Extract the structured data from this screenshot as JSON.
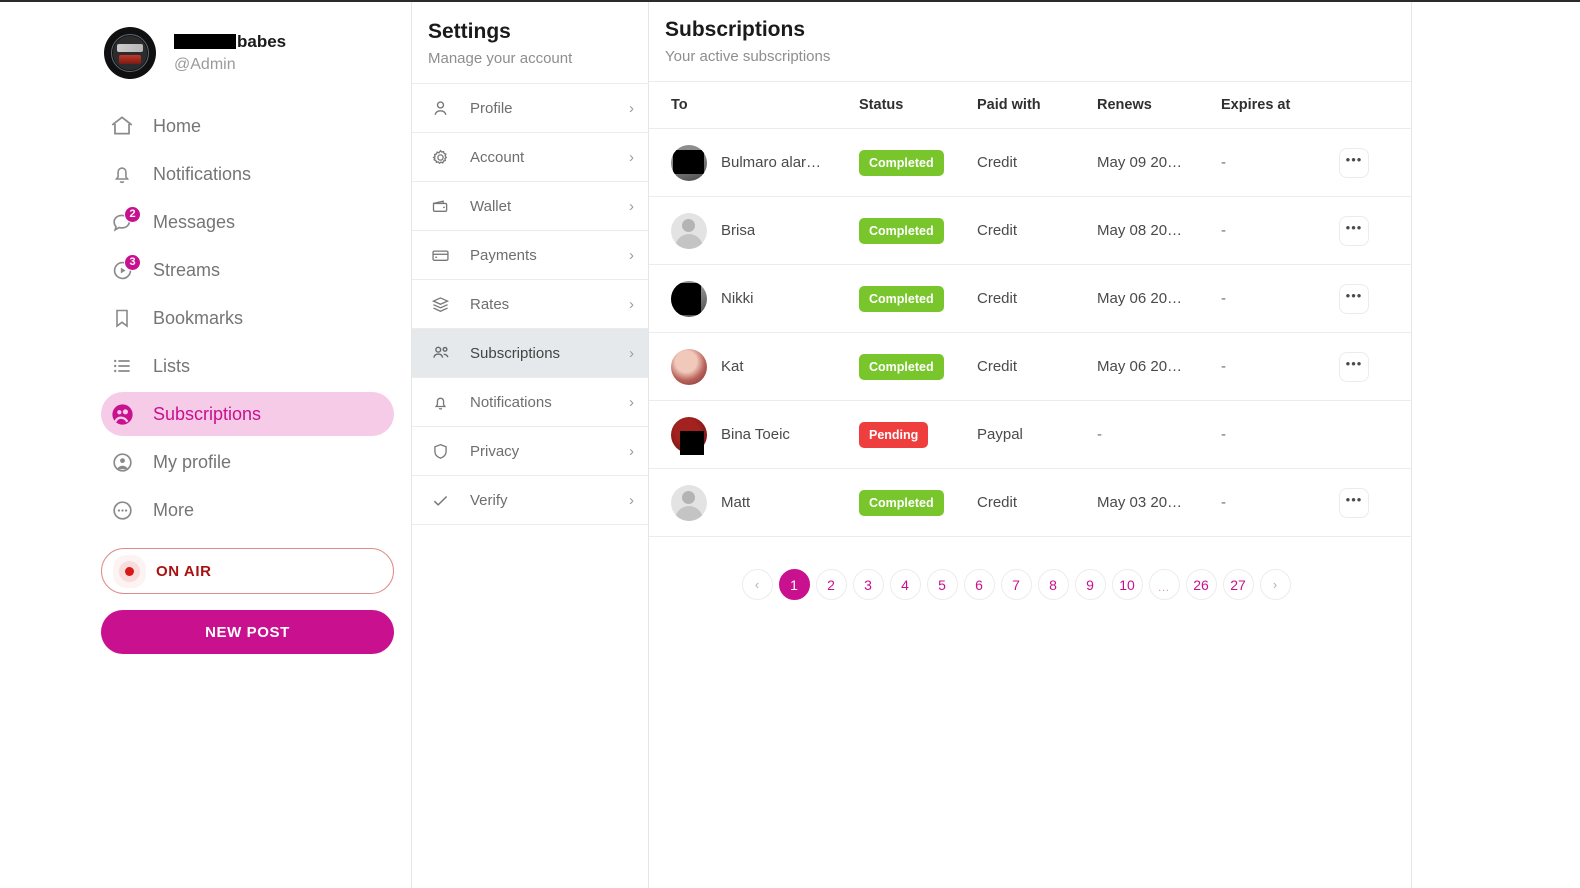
{
  "account": {
    "display_name_suffix": "babes",
    "display_name_redacted": true,
    "handle": "@Admin",
    "avatar_icon": "brand-logo-avatar"
  },
  "sidebar": {
    "items": [
      {
        "label": "Home",
        "icon": "home-icon",
        "badge": "",
        "active": false
      },
      {
        "label": "Notifications",
        "icon": "bell-icon",
        "badge": "",
        "active": false
      },
      {
        "label": "Messages",
        "icon": "chat-bubble-icon",
        "badge": "2",
        "active": false
      },
      {
        "label": "Streams",
        "icon": "play-circle-icon",
        "badge": "3",
        "active": false
      },
      {
        "label": "Bookmarks",
        "icon": "bookmark-icon",
        "badge": "",
        "active": false
      },
      {
        "label": "Lists",
        "icon": "list-icon",
        "badge": "",
        "active": false
      },
      {
        "label": "Subscriptions",
        "icon": "people-circle-icon",
        "badge": "",
        "active": true
      },
      {
        "label": "My profile",
        "icon": "user-circle-icon",
        "badge": "",
        "active": false
      },
      {
        "label": "More",
        "icon": "ellipsis-circle-icon",
        "badge": "",
        "active": false
      }
    ],
    "on_air_label": "ON AIR",
    "new_post_label": "NEW POST"
  },
  "settings": {
    "title": "Settings",
    "subtitle": "Manage your account",
    "items": [
      {
        "label": "Profile",
        "icon": "person-icon",
        "selected": false
      },
      {
        "label": "Account",
        "icon": "gear-icon",
        "selected": false
      },
      {
        "label": "Wallet",
        "icon": "wallet-icon",
        "selected": false
      },
      {
        "label": "Payments",
        "icon": "card-icon",
        "selected": false
      },
      {
        "label": "Rates",
        "icon": "layers-icon",
        "selected": false
      },
      {
        "label": "Subscriptions",
        "icon": "people-icon",
        "selected": true
      },
      {
        "label": "Notifications",
        "icon": "bell-icon",
        "selected": false
      },
      {
        "label": "Privacy",
        "icon": "shield-icon",
        "selected": false
      },
      {
        "label": "Verify",
        "icon": "check-icon",
        "selected": false
      }
    ],
    "chevron": "›"
  },
  "main": {
    "title": "Subscriptions",
    "subtitle": "Your active subscriptions",
    "columns": [
      "To",
      "Status",
      "Paid with",
      "Renews",
      "Expires at"
    ],
    "rows": [
      {
        "name": "Bulmaro alar…",
        "avatar": "photo-dark",
        "avatar_redacted": true,
        "status": "Completed",
        "status_kind": "completed",
        "paid_with": "Credit",
        "renews": "May 09 20…",
        "expires_at": "-",
        "has_actions": true
      },
      {
        "name": "Brisa",
        "avatar": "default",
        "avatar_redacted": false,
        "status": "Completed",
        "status_kind": "completed",
        "paid_with": "Credit",
        "renews": "May 08 20…",
        "expires_at": "-",
        "has_actions": true
      },
      {
        "name": "Nikki",
        "avatar": "photo-dark",
        "avatar_redacted": true,
        "status": "Completed",
        "status_kind": "completed",
        "paid_with": "Credit",
        "renews": "May 06 20…",
        "expires_at": "-",
        "has_actions": true
      },
      {
        "name": "Kat",
        "avatar": "photo-kat",
        "avatar_redacted": false,
        "status": "Completed",
        "status_kind": "completed",
        "paid_with": "Credit",
        "renews": "May 06 20…",
        "expires_at": "-",
        "has_actions": true
      },
      {
        "name": "Bina Toeic",
        "avatar": "photo-red",
        "avatar_redacted": true,
        "status": "Pending",
        "status_kind": "pending",
        "paid_with": "Paypal",
        "renews": "-",
        "expires_at": "-",
        "has_actions": false
      },
      {
        "name": "Matt",
        "avatar": "default",
        "avatar_redacted": false,
        "status": "Completed",
        "status_kind": "completed",
        "paid_with": "Credit",
        "renews": "May 03 20…",
        "expires_at": "-",
        "has_actions": true
      }
    ],
    "row_action_icon": "ellipsis-horizontal-icon"
  },
  "pagination": {
    "prev": "‹",
    "next": "›",
    "ellipsis": "…",
    "pages": [
      "1",
      "2",
      "3",
      "4",
      "5",
      "6",
      "7",
      "8",
      "9",
      "10",
      "…",
      "26",
      "27"
    ],
    "current": "1"
  },
  "colors": {
    "brand_magenta": "#c9108f",
    "brand_pill_bg": "#f6cbe7",
    "status_completed": "#79c62c",
    "status_pending": "#ef3e3e",
    "on_air_red": "#a81111",
    "selected_row_bg": "#e6e9eb"
  }
}
